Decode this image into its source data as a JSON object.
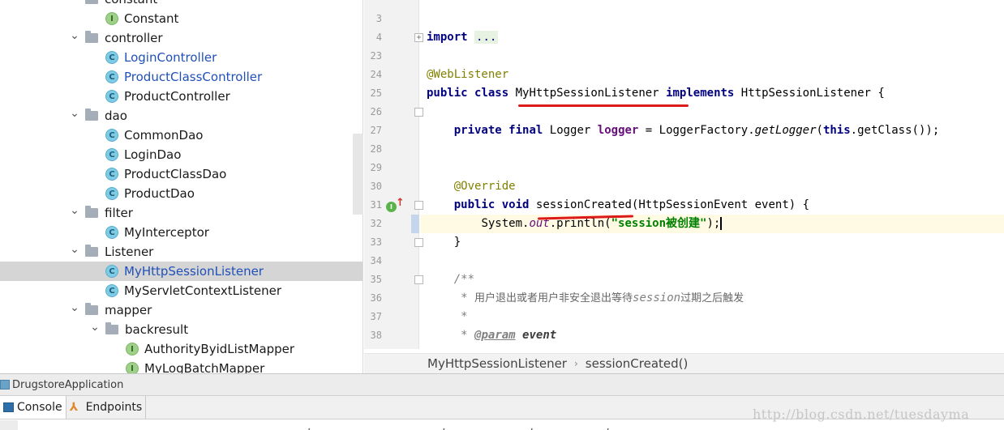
{
  "project_tree": {
    "items": [
      {
        "label": "constant",
        "type": "folder",
        "expanded": true,
        "depth": 0,
        "selected": false,
        "blue": false
      },
      {
        "label": "Constant",
        "type": "interface",
        "depth": 1,
        "selected": false,
        "blue": false
      },
      {
        "label": "controller",
        "type": "folder",
        "expanded": true,
        "depth": 0,
        "selected": false,
        "blue": false
      },
      {
        "label": "LoginController",
        "type": "class",
        "depth": 1,
        "selected": false,
        "blue": true
      },
      {
        "label": "ProductClassController",
        "type": "class",
        "depth": 1,
        "selected": false,
        "blue": true
      },
      {
        "label": "ProductController",
        "type": "class",
        "depth": 1,
        "selected": false,
        "blue": false
      },
      {
        "label": "dao",
        "type": "folder",
        "expanded": true,
        "depth": 0,
        "selected": false,
        "blue": false
      },
      {
        "label": "CommonDao",
        "type": "class",
        "depth": 1,
        "selected": false,
        "blue": false
      },
      {
        "label": "LoginDao",
        "type": "class",
        "depth": 1,
        "selected": false,
        "blue": false
      },
      {
        "label": "ProductClassDao",
        "type": "class",
        "depth": 1,
        "selected": false,
        "blue": false
      },
      {
        "label": "ProductDao",
        "type": "class",
        "depth": 1,
        "selected": false,
        "blue": false
      },
      {
        "label": "filter",
        "type": "folder",
        "expanded": true,
        "depth": 0,
        "selected": false,
        "blue": false
      },
      {
        "label": "MyInterceptor",
        "type": "class",
        "depth": 1,
        "selected": false,
        "blue": false
      },
      {
        "label": "Listener",
        "type": "folder",
        "expanded": true,
        "depth": 0,
        "selected": false,
        "blue": false
      },
      {
        "label": "MyHttpSessionListener",
        "type": "class",
        "depth": 1,
        "selected": true,
        "blue": true
      },
      {
        "label": "MyServletContextListener",
        "type": "class",
        "depth": 1,
        "selected": false,
        "blue": false
      },
      {
        "label": "mapper",
        "type": "folder",
        "expanded": true,
        "depth": 0,
        "selected": false,
        "blue": false
      },
      {
        "label": "backresult",
        "type": "folder",
        "expanded": true,
        "depth": 1,
        "selected": false,
        "blue": false
      },
      {
        "label": "AuthorityByidListMapper",
        "type": "interface",
        "depth": 2,
        "selected": false,
        "blue": false
      },
      {
        "label": "MyLogBatchMapper",
        "type": "interface",
        "depth": 2,
        "selected": false,
        "blue": false
      }
    ]
  },
  "editor": {
    "line_numbers": [
      "3",
      "4",
      "23",
      "24",
      "25",
      "26",
      "27",
      "28",
      "29",
      "30",
      "31",
      "32",
      "33",
      "34",
      "35",
      "36",
      "37",
      "38"
    ],
    "code": {
      "import_kw": "import",
      "import_folded": "...",
      "annotation_weblistener": "@WebListener",
      "l25_public": "public",
      "l25_class": "class",
      "l25_name": "MyHttpSessionListener",
      "l25_implements": "implements",
      "l25_rest": "HttpSessionListener {",
      "l27_private": "private",
      "l27_final": "final",
      "l27_type": "Logger",
      "l27_field": "logger",
      "l27_eq": "= LoggerFactory.",
      "l27_method": "getLogger",
      "l27_open": "(",
      "l27_this": "this",
      "l27_rest": ".getClass());",
      "annotation_override": "@Override",
      "l31_public": "public",
      "l31_void": "void",
      "l31_method": "sessionCreated",
      "l31_rest": "(HttpSessionEvent event) {",
      "l32_sys": "System.",
      "l32_out": "out",
      "l32_println": ".println(",
      "l32_string": "\"session被创建\"",
      "l32_end": ");",
      "l33": "}",
      "l35": "/**",
      "l36_star": "*",
      "l36_text": "用户退出或者用户非安全退出等待",
      "l36_session": "session",
      "l36_text2": "过期之后触发",
      "l37": "*",
      "l38_star": "*",
      "l38_tag": "@param",
      "l38_param": "event"
    },
    "breadcrumb": [
      "MyHttpSessionListener",
      "sessionCreated()"
    ]
  },
  "run_panel": {
    "config_name": "DrugstoreApplication",
    "tabs": [
      "Console",
      "Endpoints"
    ],
    "console_partial": "                ,                      ,              ,            ,"
  },
  "watermark": "http://blog.csdn.net/tuesdayma",
  "colors": {
    "keyword": "#000080",
    "annotation": "#808000",
    "string": "#008000",
    "field": "#660e7a",
    "selection": "#d5d5d5",
    "red_underline": "#dd1a1a"
  }
}
